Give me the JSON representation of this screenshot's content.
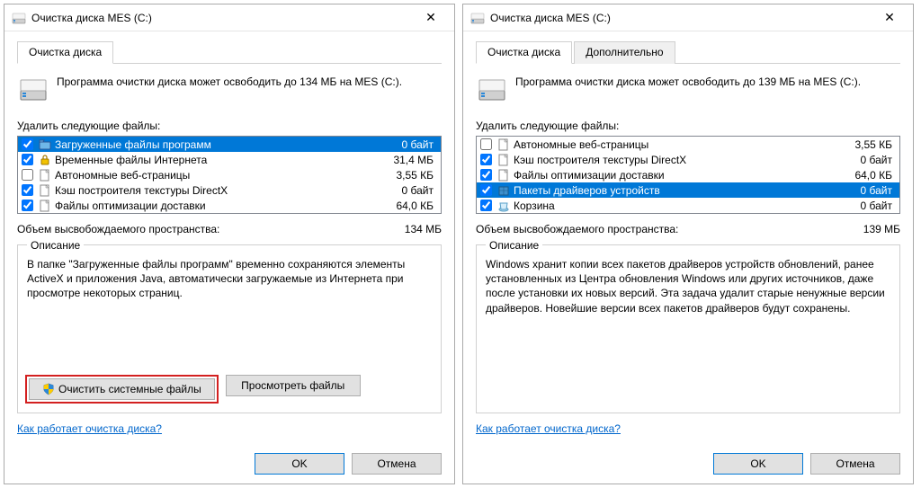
{
  "left": {
    "title": "Очистка диска MES (C:)",
    "tabs": [
      "Очистка диска"
    ],
    "info_text": "Программа очистки диска может освободить до 134 МБ на MES (C:).",
    "del_label": "Удалить следующие файлы:",
    "rows": [
      {
        "checked": true,
        "label": "Загруженные файлы программ",
        "size": "0 байт",
        "selected": true,
        "icon": "folder-dl"
      },
      {
        "checked": true,
        "label": "Временные файлы Интернета",
        "size": "31,4 МБ",
        "selected": false,
        "icon": "lock"
      },
      {
        "checked": false,
        "label": "Автономные веб-страницы",
        "size": "3,55 КБ",
        "selected": false,
        "icon": "page"
      },
      {
        "checked": true,
        "label": "Кэш построителя текстуры DirectX",
        "size": "0 байт",
        "selected": false,
        "icon": "page"
      },
      {
        "checked": true,
        "label": "Файлы оптимизации доставки",
        "size": "64,0 КБ",
        "selected": false,
        "icon": "page"
      }
    ],
    "summary_label": "Объем высвобождаемого пространства:",
    "summary_value": "134 МБ",
    "group_title": "Описание",
    "description": "В папке \"Загруженные файлы программ\" временно сохраняются элементы ActiveX и приложения Java, автоматически загружаемые из Интернета при просмотре некоторых страниц.",
    "clean_sys_btn": "Очистить системные файлы",
    "view_files_btn": "Просмотреть файлы",
    "link": "Как работает очистка диска?",
    "ok": "OK",
    "cancel": "Отмена"
  },
  "right": {
    "title": "Очистка диска MES (C:)",
    "tabs": [
      "Очистка диска",
      "Дополнительно"
    ],
    "info_text": "Программа очистки диска может освободить до 139 МБ на MES (C:).",
    "del_label": "Удалить следующие файлы:",
    "rows": [
      {
        "checked": false,
        "label": "Автономные веб-страницы",
        "size": "3,55 КБ",
        "selected": false,
        "icon": "page"
      },
      {
        "checked": true,
        "label": "Кэш построителя текстуры DirectX",
        "size": "0 байт",
        "selected": false,
        "icon": "page"
      },
      {
        "checked": true,
        "label": "Файлы оптимизации доставки",
        "size": "64,0 КБ",
        "selected": false,
        "icon": "page"
      },
      {
        "checked": true,
        "label": "Пакеты драйверов устройств",
        "size": "0 байт",
        "selected": true,
        "icon": "package"
      },
      {
        "checked": true,
        "label": "Корзина",
        "size": "0 байт",
        "selected": false,
        "icon": "recycle"
      }
    ],
    "summary_label": "Объем высвобождаемого пространства:",
    "summary_value": "139 МБ",
    "group_title": "Описание",
    "description": "Windows хранит копии всех пакетов драйверов устройств обновлений, ранее установленных из Центра обновления Windows или других источников, даже после установки их новых версий. Эта задача удалит старые ненужные версии драйверов. Новейшие версии всех пакетов драйверов будут сохранены.",
    "link": "Как работает очистка диска?",
    "ok": "OK",
    "cancel": "Отмена"
  }
}
